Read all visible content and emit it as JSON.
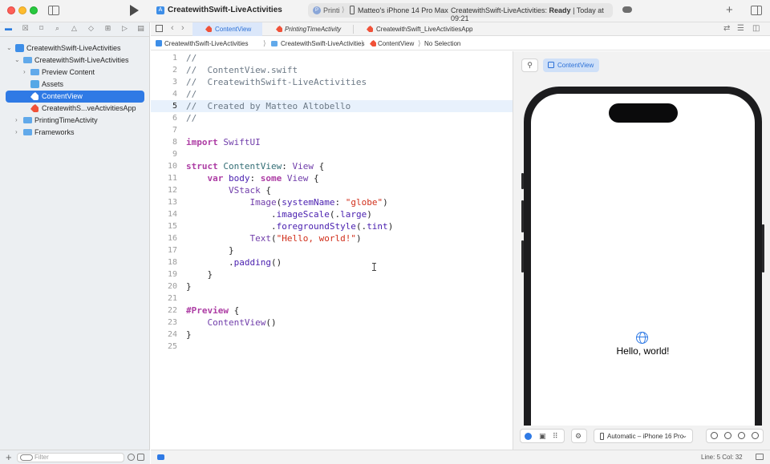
{
  "window": {
    "project_title": "CreatewithSwift-LiveActivities",
    "scheme": {
      "app": "Printi",
      "separator": "⟩",
      "device": "Matteo's iPhone 14 Pro Max",
      "status_prefix": "CreatewithSwift-LiveActivities: ",
      "status_state": "Ready",
      "status_suffix": " | Today at 09:21"
    }
  },
  "navigator": {
    "tree": [
      {
        "label": "CreatewithSwift-LiveActivities",
        "chevron": "⌄"
      },
      {
        "label": "CreatewithSwift-LiveActivities",
        "chevron": "⌄"
      },
      {
        "label": "Preview Content",
        "chevron": "›"
      },
      {
        "label": "Assets",
        "chevron": ""
      },
      {
        "label": "ContentView",
        "chevron": ""
      },
      {
        "label": "CreatewithS...veActivitiesApp",
        "chevron": ""
      },
      {
        "label": "PrintingTimeActivity",
        "chevron": "›"
      },
      {
        "label": "Frameworks",
        "chevron": "›"
      }
    ],
    "filter_placeholder": "Filter",
    "add_label": "+"
  },
  "tabs": [
    {
      "label": "ContentView"
    },
    {
      "label": "PrintingTimeActivity"
    },
    {
      "label": "CreatewithSwift_LiveActivitiesApp"
    }
  ],
  "jumpbar": {
    "project": "CreatewithSwift-LiveActivities",
    "folder": "CreatewithSwift-LiveActivities",
    "file": "ContentView",
    "selection": "No Selection",
    "sep": "⟩"
  },
  "code": {
    "lines": [
      {
        "n": "1",
        "t": "//"
      },
      {
        "n": "2",
        "t": "//  ContentView.swift"
      },
      {
        "n": "3",
        "t": "//  CreatewithSwift-LiveActivities"
      },
      {
        "n": "4",
        "t": "//"
      },
      {
        "n": "5",
        "t": "//  Created by Matteo Altobello"
      },
      {
        "n": "6",
        "t": "//"
      },
      {
        "n": "7",
        "t": ""
      },
      {
        "n": "8",
        "t": "import SwiftUI"
      },
      {
        "n": "9",
        "t": ""
      },
      {
        "n": "10",
        "t": "struct ContentView: View {"
      },
      {
        "n": "11",
        "t": "    var body: some View {"
      },
      {
        "n": "12",
        "t": "        VStack {"
      },
      {
        "n": "13",
        "t": "            Image(systemName: \"globe\")"
      },
      {
        "n": "14",
        "t": "                .imageScale(.large)"
      },
      {
        "n": "15",
        "t": "                .foregroundStyle(.tint)"
      },
      {
        "n": "16",
        "t": "            Text(\"Hello, world!\")"
      },
      {
        "n": "17",
        "t": "        }"
      },
      {
        "n": "18",
        "t": "        .padding()"
      },
      {
        "n": "19",
        "t": "    }"
      },
      {
        "n": "20",
        "t": "}"
      },
      {
        "n": "21",
        "t": ""
      },
      {
        "n": "22",
        "t": "#Preview {"
      },
      {
        "n": "23",
        "t": "    ContentView()"
      },
      {
        "n": "24",
        "t": "}"
      },
      {
        "n": "25",
        "t": ""
      }
    ],
    "current_line": 5
  },
  "canvas": {
    "chip_label": "ContentView",
    "preview_text": "Hello, world!",
    "device_selector": "Automatic – iPhone 16 Pro",
    "device_chevron": "⌄"
  },
  "statusbar": {
    "position": "Line: 5  Col: 32"
  },
  "colors": {
    "accent": "#2f7ae5",
    "swift": "#f05138",
    "keyword": "#ad3da4",
    "string": "#d12f1b",
    "comment": "#6c7986"
  },
  "icons": {
    "nav_tools": [
      "folder-icon",
      "source-control-icon",
      "bookmark-icon",
      "find-icon",
      "issues-icon",
      "tests-icon",
      "debug-icon",
      "breakpoints-icon",
      "reports-icon"
    ]
  }
}
